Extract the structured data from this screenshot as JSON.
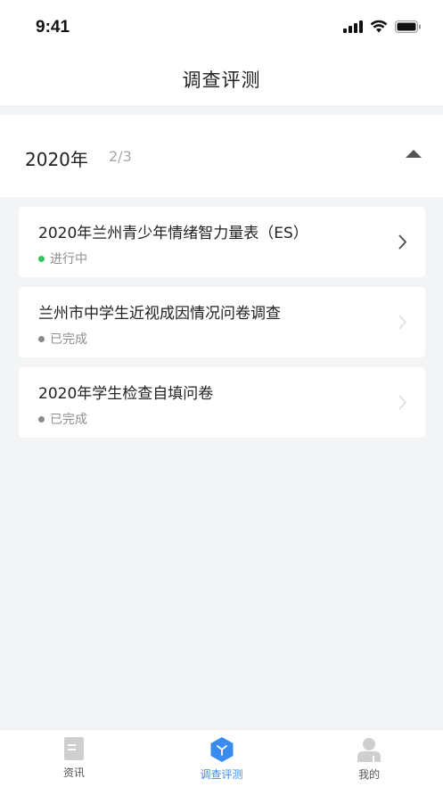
{
  "status_bar": {
    "time": "9:41"
  },
  "nav": {
    "title": "调查评测"
  },
  "year_section": {
    "year": "2020年",
    "count": "2/3",
    "expanded": true
  },
  "surveys": [
    {
      "title": "2020年兰州青少年情绪智力量表（ES）",
      "status": "进行中",
      "status_color": "#2ec45b",
      "active": true
    },
    {
      "title": "兰州市中学生近视成因情况问卷调查",
      "status": "已完成",
      "status_color": "#8a8a8a",
      "active": false
    },
    {
      "title": "2020年学生检查自填问卷",
      "status": "已完成",
      "status_color": "#8a8a8a",
      "active": false
    }
  ],
  "tabs": [
    {
      "label": "资讯",
      "icon": "document-icon",
      "active": false
    },
    {
      "label": "调查评测",
      "icon": "cube-icon",
      "active": true
    },
    {
      "label": "我的",
      "icon": "user-icon",
      "active": false
    }
  ],
  "colors": {
    "accent": "#3a8bf0",
    "background": "#f3f4f6",
    "in_progress": "#2ec45b",
    "done": "#8a8a8a"
  }
}
